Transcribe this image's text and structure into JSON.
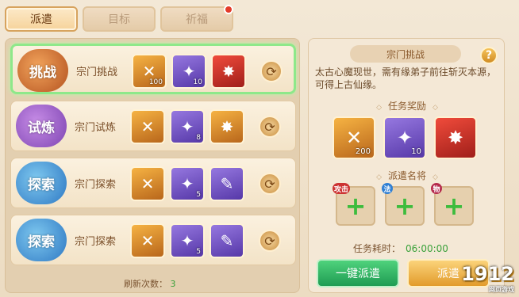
{
  "tabs": [
    {
      "label": "派遣",
      "active": true
    },
    {
      "label": "目标",
      "active": false
    },
    {
      "label": "祈福",
      "active": false
    }
  ],
  "rows": [
    {
      "badge": "挑战",
      "badge_color": "orange",
      "name": "宗门挑战",
      "items": [
        {
          "icon": "✕",
          "q": "orange",
          "count": "100"
        },
        {
          "icon": "✦",
          "q": "purple",
          "count": "10"
        },
        {
          "icon": "✸",
          "q": "red",
          "count": ""
        }
      ]
    },
    {
      "badge": "试炼",
      "badge_color": "purple",
      "name": "宗门试炼",
      "items": [
        {
          "icon": "✕",
          "q": "orange",
          "count": ""
        },
        {
          "icon": "✦",
          "q": "purple",
          "count": "8"
        },
        {
          "icon": "✸",
          "q": "orange",
          "count": ""
        }
      ]
    },
    {
      "badge": "探索",
      "badge_color": "blue",
      "name": "宗门探索",
      "items": [
        {
          "icon": "✕",
          "q": "orange",
          "count": ""
        },
        {
          "icon": "✦",
          "q": "purple",
          "count": "5"
        },
        {
          "icon": "✎",
          "q": "purple",
          "count": ""
        }
      ]
    },
    {
      "badge": "探索",
      "badge_color": "blue",
      "name": "宗门探索",
      "items": [
        {
          "icon": "✕",
          "q": "orange",
          "count": ""
        },
        {
          "icon": "✦",
          "q": "purple",
          "count": "5"
        },
        {
          "icon": "✎",
          "q": "purple",
          "count": ""
        }
      ]
    }
  ],
  "refresh": {
    "label": "刷新次数：",
    "count": "3"
  },
  "detail": {
    "title": "宗门挑战",
    "help": "?",
    "description": "太古心魔现世，需有缘弟子前往斩灭本源，可得上古仙缘。",
    "reward_title": "任务奖励",
    "rewards": [
      {
        "icon": "✕",
        "q": "orange",
        "count": "200"
      },
      {
        "icon": "✦",
        "q": "purple",
        "count": "10"
      },
      {
        "icon": "✸",
        "q": "red",
        "count": ""
      }
    ],
    "dispatch_title": "派遣名将",
    "slots": [
      {
        "tag": "攻击"
      },
      {
        "tag": "法"
      },
      {
        "tag": "物"
      }
    ],
    "time_label": "任务耗时：",
    "time_value": "06:00:00",
    "btn_dispatch": "一键派遣",
    "btn_confirm": "派遣"
  },
  "logo": {
    "main": "1912",
    "sub": "网页游戏"
  }
}
